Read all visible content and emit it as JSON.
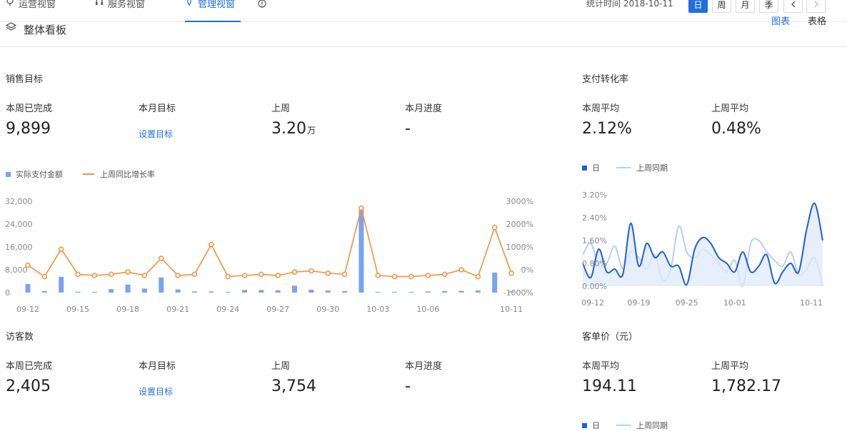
{
  "tabs": [
    {
      "label": "运营视窗"
    },
    {
      "label": "服务视窗"
    },
    {
      "label": "管理视窗"
    }
  ],
  "stats_time_label": "统计时间",
  "stats_date": "2018-10-11",
  "period_buttons": [
    "日",
    "周",
    "月",
    "季"
  ],
  "panel": {
    "title": "整体看板",
    "view_chart": "图表",
    "view_table": "表格"
  },
  "sales": {
    "title": "销售目标",
    "week_done_label": "本周已完成",
    "week_done_value": "9,899",
    "month_target_label": "本月目标",
    "month_target_link": "设置目标",
    "last_week_label": "上周",
    "last_week_value": "3.20",
    "last_week_unit": "万",
    "month_progress_label": "本月进度",
    "month_progress_value": "-"
  },
  "conversion": {
    "title": "支付转化率",
    "week_avg_label": "本周平均",
    "week_avg_value": "2.12%",
    "last_week_avg_label": "上周平均",
    "last_week_avg_value": "0.48%"
  },
  "visitors": {
    "title": "访客数",
    "week_done_label": "本周已完成",
    "week_done_value": "2,405",
    "month_target_label": "本月目标",
    "month_target_link": "设置目标",
    "last_week_label": "上周",
    "last_week_value": "3,754",
    "month_progress_label": "本月进度",
    "month_progress_value": "-"
  },
  "unit_price": {
    "title": "客单价（元）",
    "week_avg_label": "本周平均",
    "week_avg_value": "194.11",
    "last_week_avg_label": "上周平均",
    "last_week_avg_value": "1,782.17"
  },
  "colors": {
    "accent": "#1f6fde",
    "bar": "#7ba3ef",
    "line_orange": "#f5903b",
    "area_fill": "#dfe9fb",
    "light_line": "#b7cff3"
  },
  "chart_data": [
    {
      "type": "bar",
      "legend": [
        "实际支付金额",
        "上周同比增长率"
      ],
      "x_tick_labels": [
        "09-12",
        "09-15",
        "09-18",
        "09-21",
        "09-24",
        "09-27",
        "09-30",
        "10-03",
        "10-06",
        "10-11"
      ],
      "y_left_ticks": [
        "32,000",
        "24,000",
        "16,000",
        "8,000",
        "0"
      ],
      "y_right_ticks": [
        "3000%",
        "2000%",
        "1000%",
        "0%",
        "-1000%"
      ],
      "ylim_left": [
        0,
        32000
      ],
      "ylim_right": [
        -1000,
        3000
      ],
      "series": [
        {
          "name": "实际支付金额",
          "kind": "bar",
          "values": [
            3000,
            500,
            5500,
            300,
            200,
            1200,
            2800,
            1400,
            5300,
            1100,
            400,
            400,
            0,
            900,
            900,
            800,
            2400,
            1000,
            700,
            500,
            29000,
            200,
            100,
            200,
            400,
            500,
            600,
            700,
            7000,
            400
          ]
        },
        {
          "name": "上周同比增长率",
          "kind": "line",
          "values": [
            200,
            -300,
            900,
            -200,
            -250,
            -200,
            -100,
            -250,
            500,
            -250,
            -200,
            1100,
            -300,
            -250,
            -200,
            -250,
            -100,
            -50,
            -150,
            -200,
            2700,
            -250,
            -300,
            -300,
            -250,
            -200,
            0,
            -300,
            1850,
            -150
          ]
        }
      ]
    },
    {
      "type": "area",
      "legend": [
        "日",
        "上周同期"
      ],
      "x_tick_labels": [
        "09-12",
        "09-19",
        "09-25",
        "10-01",
        "10-11"
      ],
      "y_ticks": [
        "3.20%",
        "2.40%",
        "1.60%",
        "0.80%",
        "0.00%"
      ],
      "ylim": [
        0,
        3.2
      ],
      "series": [
        {
          "name": "日",
          "kind": "area",
          "values": [
            0.8,
            0.3,
            1.3,
            0.5,
            0.6,
            0.4,
            2.2,
            0.7,
            1.5,
            1.0,
            1.2,
            0.7,
            0.7,
            0.05,
            1.3,
            1.7,
            1.5,
            1.0,
            0.8,
            0.5,
            1.2,
            0.5,
            0.7,
            1.1,
            0.1,
            0.5,
            0.8,
            0.5,
            2.0,
            2.9,
            1.6
          ]
        },
        {
          "name": "上周同期",
          "kind": "line",
          "values": [
            1.1,
            1.5,
            0.7,
            0.8,
            1.4,
            0.6,
            1.2,
            1.0,
            0.6,
            1.1,
            0.2,
            0.6,
            2.1,
            1.2,
            1.0,
            1.3,
            1.1,
            0.8,
            0.5,
            0.9,
            0.0,
            1.5,
            1.6,
            1.2,
            0.9,
            0.7,
            1.2,
            0.4,
            0.6,
            1.0,
            0.0
          ]
        }
      ]
    }
  ],
  "bottom_legend": [
    "日",
    "上周同期"
  ]
}
